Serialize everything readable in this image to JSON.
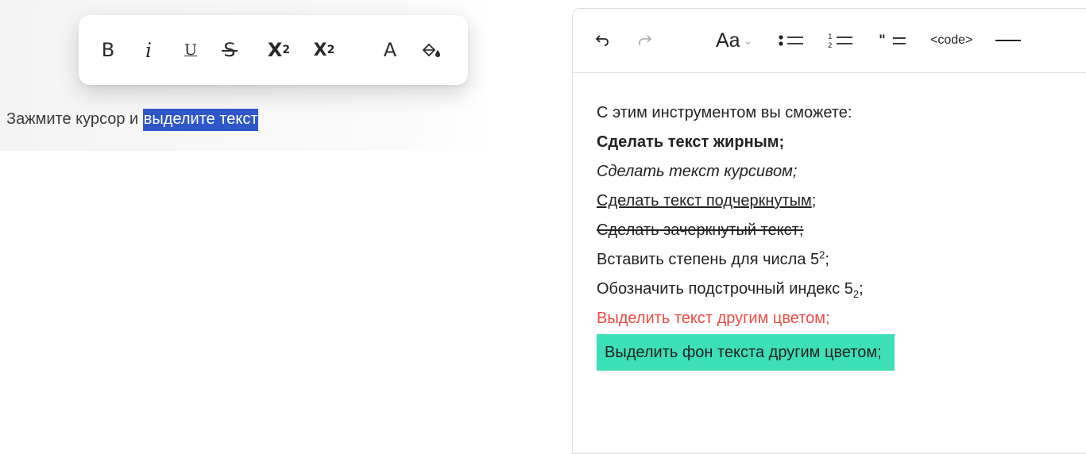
{
  "float_toolbar": {
    "bold": "B",
    "italic": "i",
    "underline": "U",
    "strike": "S",
    "superscript_base": "X",
    "superscript_exp": "2",
    "subscript_base": "X",
    "subscript_idx": "2",
    "text_color": "A",
    "fill_icon": "paint-bucket"
  },
  "demo": {
    "text": "Зажмите курсор и ",
    "selected": "выделите текст",
    "selection_color": "#2f57c8"
  },
  "editor": {
    "toolbar": {
      "undo": "↶",
      "redo": "↷",
      "font": "Aa",
      "font_chevron": "⌄",
      "code": "<code>"
    },
    "lines": {
      "intro": "С этим инструментом вы сможете:",
      "bold": "Сделать текст жирным;",
      "italic": "Сделать текст курсивом;",
      "underline": "Сделать текст подчеркнутым",
      "underline_suffix": ";",
      "strike": "Сделать зачеркнутый текст;",
      "sup_prefix": "Вставить степень для числа 5",
      "sup": "2",
      "sup_suffix": ";",
      "sub_prefix": "Обозначить подстрочный индекс 5",
      "sub": "2",
      "sub_suffix": ";",
      "color": "Выделить текст другим цветом;",
      "background": "Выделить фон текста другим цветом;"
    },
    "colors": {
      "red_text": "#ef4b44",
      "highlight_bg": "#3ddfb6"
    }
  }
}
